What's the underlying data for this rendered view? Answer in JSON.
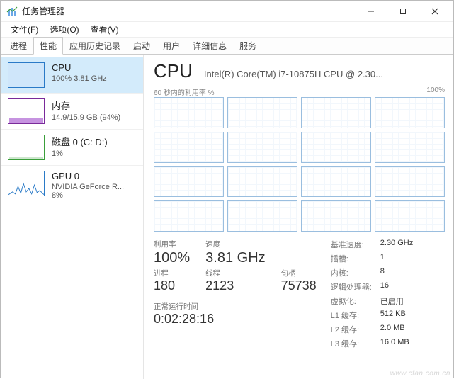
{
  "window": {
    "title": "任务管理器"
  },
  "menu": {
    "file": "文件(F)",
    "options": "选项(O)",
    "view": "查看(V)"
  },
  "tabs": {
    "processes": "进程",
    "performance": "性能",
    "apphistory": "应用历史记录",
    "startup": "启动",
    "users": "用户",
    "details": "详细信息",
    "services": "服务"
  },
  "sidebar": {
    "cpu": {
      "title": "CPU",
      "sub": "100%  3.81 GHz"
    },
    "mem": {
      "title": "内存",
      "sub": "14.9/15.9 GB (94%)"
    },
    "disk": {
      "title": "磁盘 0 (C: D:)",
      "sub": "1%"
    },
    "gpu": {
      "title": "GPU 0",
      "sub1": "NVIDIA GeForce R...",
      "sub2": "8%"
    }
  },
  "main": {
    "heading": "CPU",
    "model": "Intel(R) Core(TM) i7-10875H CPU @ 2.30...",
    "chart_caption_left": "60 秒内的利用率 %",
    "chart_caption_right": "100%"
  },
  "stats_left": {
    "utilization_label": "利用率",
    "utilization_value": "100%",
    "speed_label": "速度",
    "speed_value": "3.81 GHz",
    "processes_label": "进程",
    "processes_value": "180",
    "threads_label": "线程",
    "threads_value": "2123",
    "handles_label": "句柄",
    "handles_value": "75738",
    "uptime_label": "正常运行时间",
    "uptime_value": "0:02:28:16"
  },
  "stats_right": {
    "basefreq_label": "基准速度:",
    "basefreq_value": "2.30 GHz",
    "sockets_label": "插槽:",
    "sockets_value": "1",
    "cores_label": "内核:",
    "cores_value": "8",
    "logical_label": "逻辑处理器:",
    "logical_value": "16",
    "virtualization_label": "虚拟化:",
    "virtualization_value": "已启用",
    "l1_label": "L1 缓存:",
    "l1_value": "512 KB",
    "l2_label": "L2 缓存:",
    "l2_value": "2.0 MB",
    "l3_label": "L3 缓存:",
    "l3_value": "16.0 MB"
  },
  "watermark": "www.cfan.com.cn",
  "chart_data": {
    "type": "grid-of-area",
    "title": "Per-logical-processor utilization over last 60 s",
    "rows": 4,
    "cols": 4,
    "xlabel": "seconds ago (60 → 0)",
    "ylabel": "Utilization %",
    "ylim": [
      0,
      100
    ],
    "note": "All 16 cells appear empty/near-zero in the screenshot; no per-core values readable."
  }
}
